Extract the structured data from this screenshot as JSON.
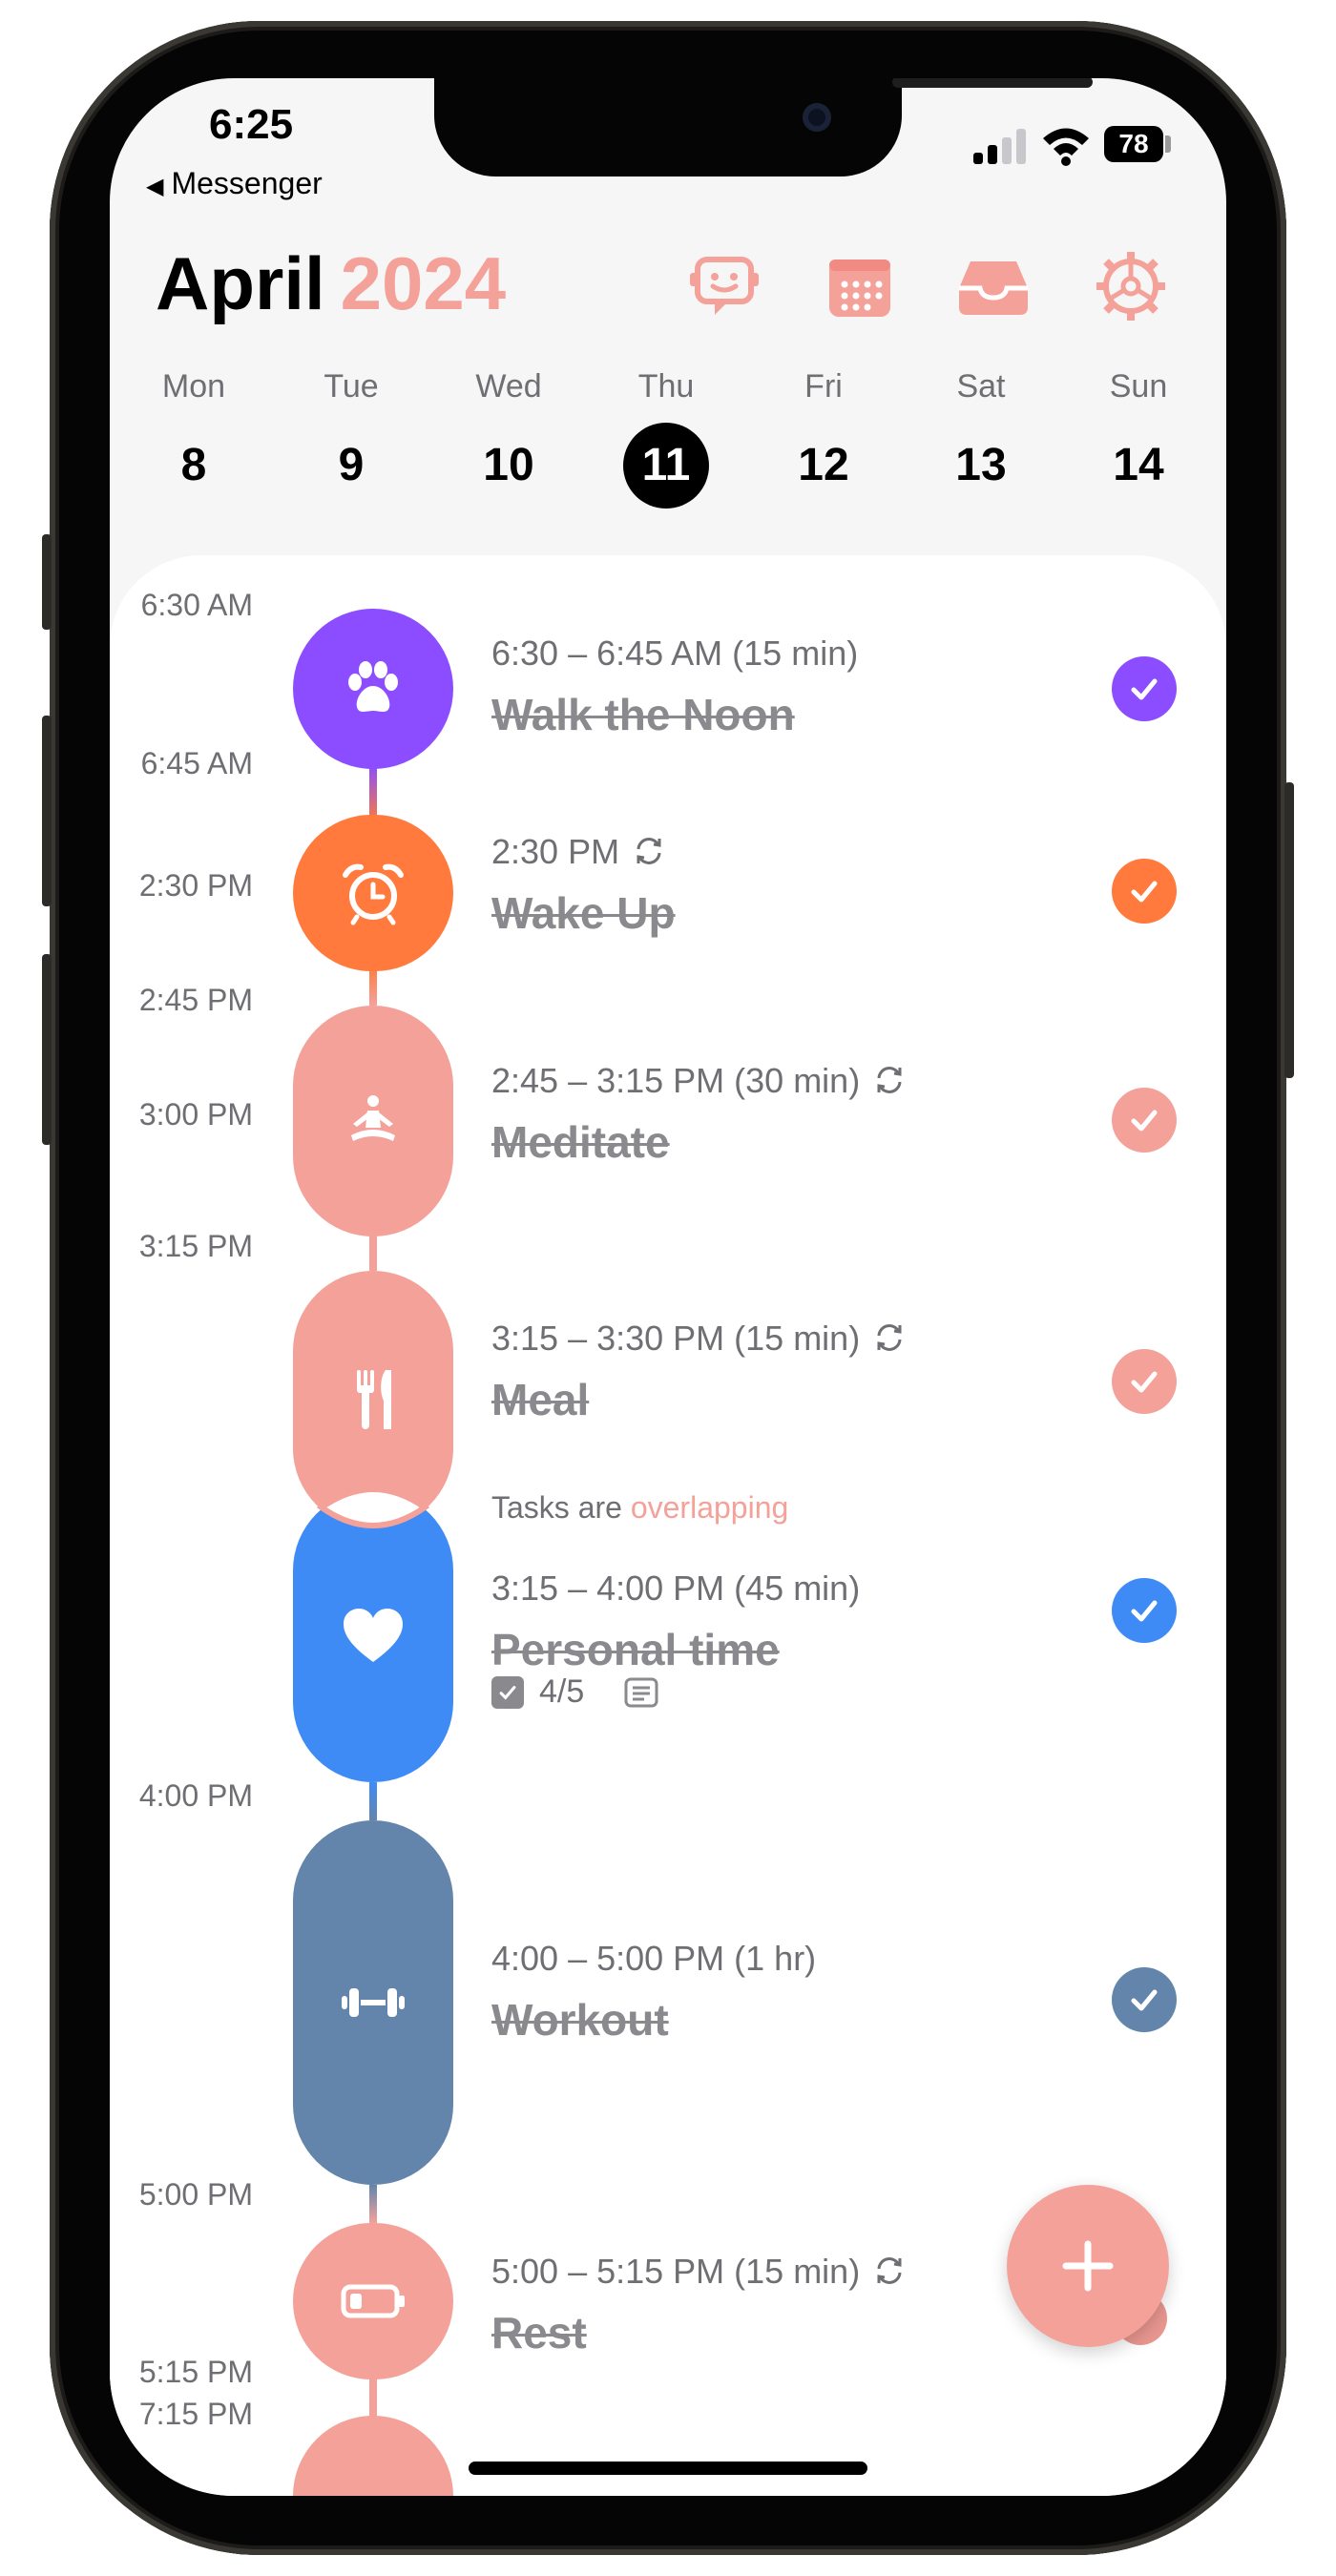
{
  "status_bar": {
    "time": "6:25",
    "back_app": "Messenger",
    "battery": "78"
  },
  "header": {
    "month": "April",
    "year": "2024"
  },
  "colors": {
    "accent": "#f4a19a",
    "purple": "#8b4dff",
    "orange": "#ff7a3c",
    "salmon": "#f4a19a",
    "blue": "#3f8bf6",
    "slate": "#6385ab"
  },
  "header_icons": [
    "assistant-chat-icon",
    "calendar-icon",
    "inbox-icon",
    "settings-icon"
  ],
  "week": [
    {
      "day": "Mon",
      "date": "8"
    },
    {
      "day": "Tue",
      "date": "9"
    },
    {
      "day": "Wed",
      "date": "10"
    },
    {
      "day": "Thu",
      "date": "11",
      "selected": true
    },
    {
      "day": "Fri",
      "date": "12"
    },
    {
      "day": "Sat",
      "date": "13"
    },
    {
      "day": "Sun",
      "date": "14"
    }
  ],
  "time_labels": [
    "6:30 AM",
    "6:45 AM",
    "2:30 PM",
    "2:45 PM",
    "3:00 PM",
    "3:15 PM",
    "4:00 PM",
    "5:00 PM",
    "5:15 PM",
    "7:15 PM"
  ],
  "tasks": [
    {
      "time": "6:30 – 6:45 AM (15 min)",
      "name": "Walk the Noon",
      "icon": "paw-icon",
      "repeat": false,
      "done": true
    },
    {
      "time": "2:30 PM",
      "name": "Wake Up",
      "icon": "alarm-clock-icon",
      "repeat": true,
      "done": true
    },
    {
      "time": "2:45 – 3:15 PM (30 min)",
      "name": "Meditate",
      "icon": "meditation-icon",
      "repeat": true,
      "done": true
    },
    {
      "time": "3:15 – 3:30 PM (15 min)",
      "name": "Meal",
      "icon": "fork-knife-icon",
      "repeat": true,
      "done": true
    },
    {
      "time": "3:15 – 4:00 PM (45 min)",
      "name": "Personal time",
      "icon": "heart-icon",
      "repeat": false,
      "done": true,
      "subtasks": "4/5"
    },
    {
      "time": "4:00 – 5:00 PM (1 hr)",
      "name": "Workout",
      "icon": "dumbbell-icon",
      "repeat": false,
      "done": true
    },
    {
      "time": "5:00 – 5:15 PM (15 min)",
      "name": "Rest",
      "icon": "battery-low-icon",
      "repeat": true,
      "done": true
    }
  ],
  "overlap_note": {
    "prefix": "Tasks are",
    "highlight": "overlapping"
  },
  "fab_label": "+"
}
